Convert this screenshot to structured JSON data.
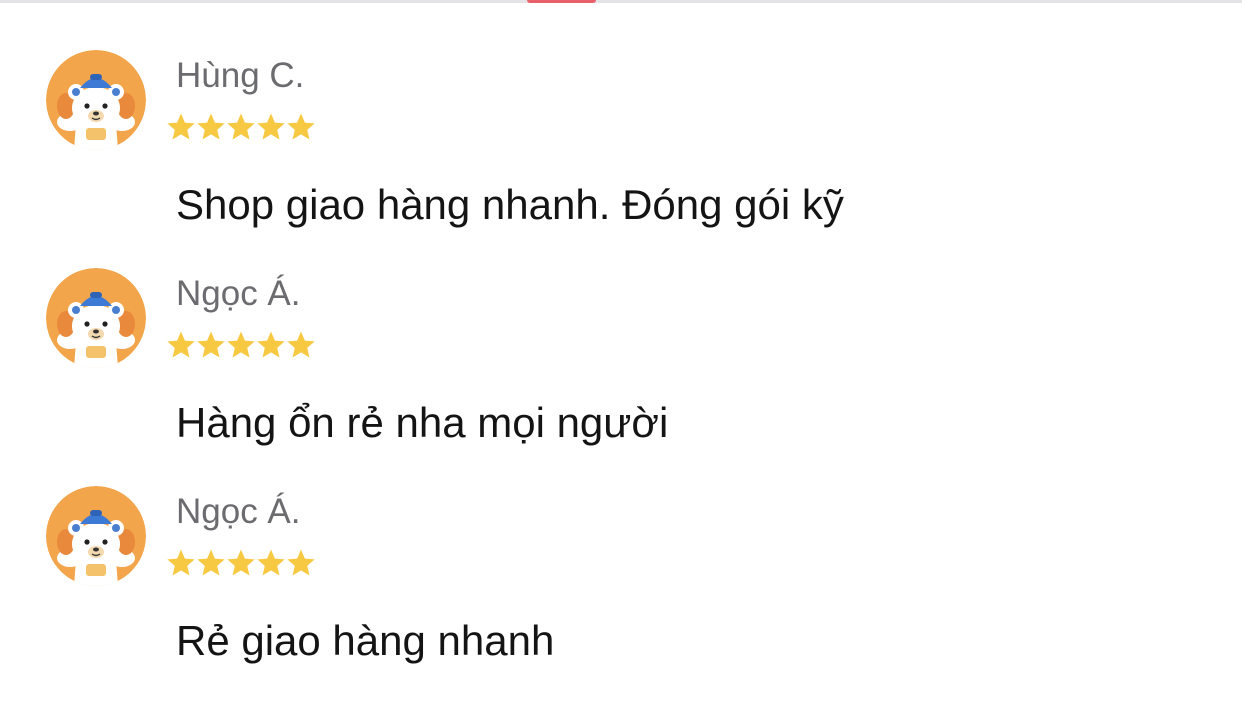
{
  "colors": {
    "star": "#f7c942",
    "name_text": "#6b6b70",
    "review_text": "#141414",
    "avatar_bg": "#f2a54b",
    "top_indicator": "#e8606a"
  },
  "reviews": [
    {
      "avatar_icon": "bear-mascot-icon",
      "name": "Hùng C.",
      "rating": 5,
      "text": "Shop giao hàng nhanh. Đóng gói kỹ"
    },
    {
      "avatar_icon": "bear-mascot-icon",
      "name": "Ngọc Á.",
      "rating": 5,
      "text": "Hàng ổn rẻ nha mọi người"
    },
    {
      "avatar_icon": "bear-mascot-icon",
      "name": "Ngọc Á.",
      "rating": 5,
      "text": "Rẻ giao hàng nhanh"
    }
  ]
}
